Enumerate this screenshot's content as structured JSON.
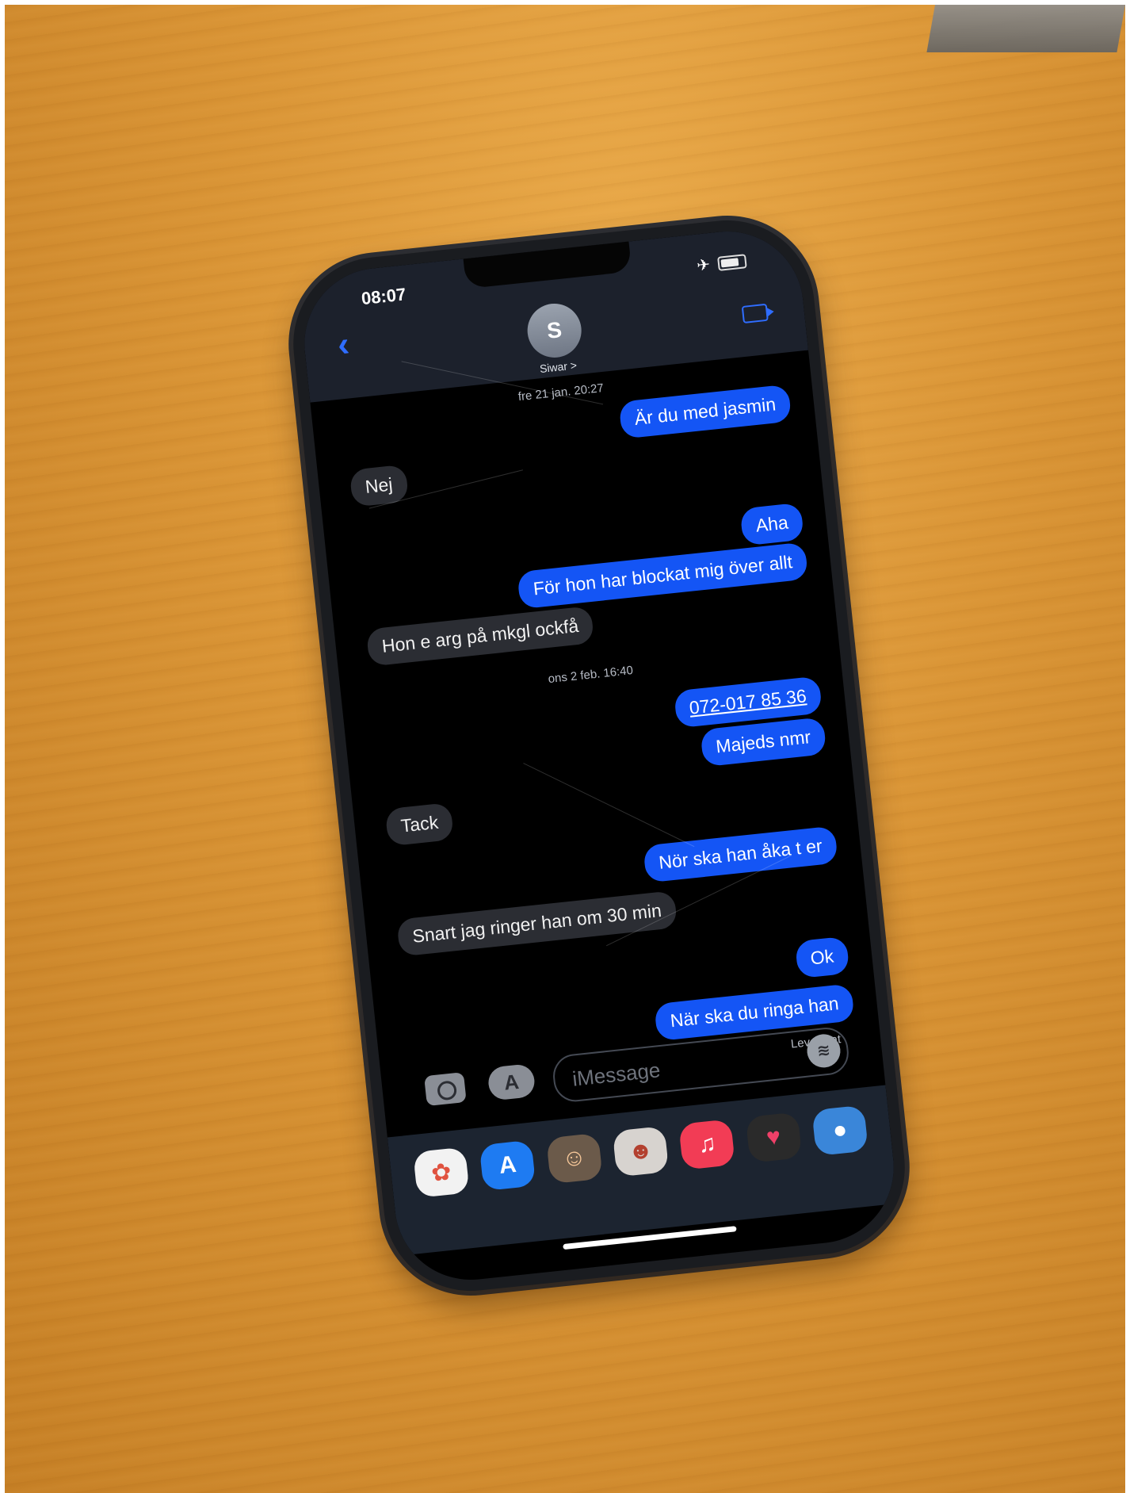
{
  "status_bar": {
    "time": "08:07"
  },
  "contact": {
    "initial": "S",
    "name": "Siwar >"
  },
  "messages": [
    {
      "type": "timestamp",
      "text": "fre 21 jan. 20:27"
    },
    {
      "type": "out",
      "text": "Är du med jasmin"
    },
    {
      "type": "in",
      "text": "Nej"
    },
    {
      "type": "out",
      "text": "Aha"
    },
    {
      "type": "out",
      "text": "För hon har blockat mig över allt"
    },
    {
      "type": "in",
      "text": "Hon e arg på mkgl ockfå"
    },
    {
      "type": "timestamp",
      "text": "ons 2 feb. 16:40"
    },
    {
      "type": "out",
      "text": "072-017 85 36",
      "link": true
    },
    {
      "type": "out",
      "text": "Majeds nmr"
    },
    {
      "type": "in",
      "text": "Tack"
    },
    {
      "type": "out",
      "text": "Nör ska han åka t er"
    },
    {
      "type": "in",
      "text": "Snart jag ringer han om 30 min"
    },
    {
      "type": "out",
      "text": "Ok"
    },
    {
      "type": "out",
      "text": "När ska du ringa han"
    }
  ],
  "delivered_label": "Levererat",
  "compose": {
    "placeholder": "iMessage"
  },
  "app_tray": [
    "photos-icon",
    "appstore-icon",
    "memoji-stickers-icon",
    "memoji-icon",
    "music-icon",
    "digital-touch-icon",
    "8-ball-pool-icon"
  ],
  "colors": {
    "outgoing_bubble": "#1455f5",
    "incoming_bubble": "#2b2d33",
    "accent": "#2f6dff",
    "table": "#d99435"
  }
}
